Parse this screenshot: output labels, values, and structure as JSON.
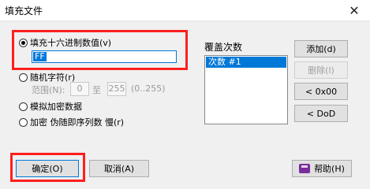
{
  "window": {
    "title": "填充文件",
    "close_glyph": "✕"
  },
  "fill_hex": {
    "label": "填充十六进制数值(v)",
    "value": "FF",
    "selected": true
  },
  "random": {
    "label": "随机字符(r)",
    "range_label": "范围(N):",
    "from": "0",
    "to_label": "至",
    "to": "255",
    "hint": "(0..255)"
  },
  "simulate_encrypt": {
    "label": "模拟加密数据"
  },
  "encrypt": {
    "label": "加密 伪随即序列数 慢(r)"
  },
  "overwrite": {
    "title": "覆盖次数",
    "items": [
      "次数 #1"
    ]
  },
  "side_buttons": {
    "add": "添加(d)",
    "delete": "删除(l)",
    "hex00": "< 0x00",
    "dod": "< DoD"
  },
  "footer": {
    "ok": "确定(O)",
    "cancel": "取消(A)",
    "help": "帮助(H)"
  },
  "colors": {
    "highlight": "#ff1f1f",
    "selection": "#0078d7",
    "help_icon": "#7a2c9a"
  }
}
